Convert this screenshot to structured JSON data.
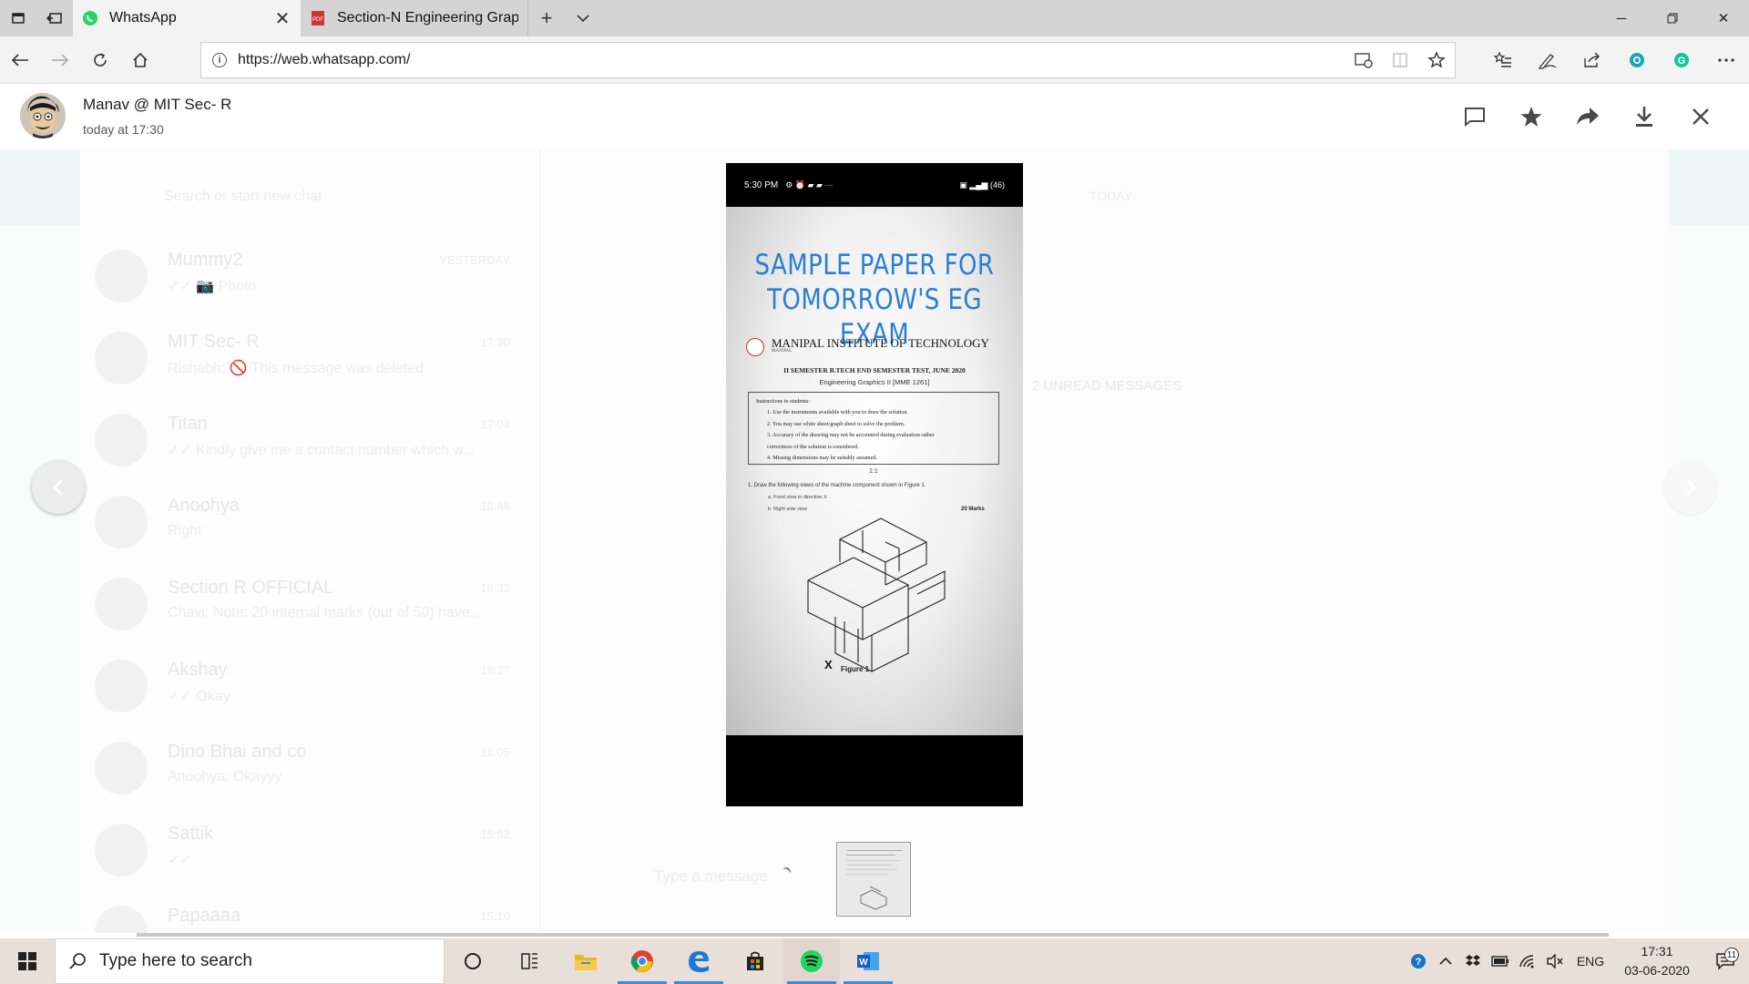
{
  "browser": {
    "tabs": [
      {
        "title": "WhatsApp",
        "active": true
      },
      {
        "title": "Section-N Engineering Grap",
        "active": false
      }
    ],
    "url": "https://web.whatsapp.com/"
  },
  "viewer": {
    "sender_name": "Manav @ MIT Sec- R",
    "timestamp": "today at 17:30",
    "actions": [
      "message-icon",
      "star-icon",
      "forward-icon",
      "download-icon",
      "close-icon"
    ]
  },
  "background_chats": {
    "search_placeholder": "Search or start new chat",
    "today_label": "TODAY",
    "unread_label": "2 UNREAD MESSAGES",
    "compose_placeholder": "Type a message",
    "items": [
      {
        "name": "Mummy2",
        "time": "YESTERDAY",
        "message": "✓✓ 📷 Photo"
      },
      {
        "name": "MIT Sec- R",
        "time": "17:30",
        "message": "Rishabh: 🚫 This message was deleted"
      },
      {
        "name": "Titan",
        "time": "17:04",
        "message": "✓✓ Kindly give me a contact number which w..."
      },
      {
        "name": "Anoohya",
        "time": "16:46",
        "message": "Right"
      },
      {
        "name": "Section R OFFICIAL",
        "time": "16:33",
        "message": "Chavi: Note: 20 internal marks (out of 50) have..."
      },
      {
        "name": "Akshay",
        "time": "16:27",
        "message": "✓✓ Okay"
      },
      {
        "name": "Dino Bhai and co",
        "time": "16:05",
        "message": "Anoohya: Okayyy"
      },
      {
        "name": "Sattik",
        "time": "15:52",
        "message": "✓✓"
      },
      {
        "name": "Papaaaa",
        "time": "15:10",
        "message": ""
      }
    ]
  },
  "photo": {
    "status_time": "5:30 PM",
    "status_right": "46",
    "title_line1": "SAMPLE PAPER FOR",
    "title_line2": "TOMORROW'S EG EXAM",
    "institute": "MANIPAL INSTITUTE OF TECHNOLOGY",
    "institute_sub": "MANIPAL",
    "exam": "II SEMESTER B.TECH END SEMESTER TEST, JUNE 2020",
    "course": "Engineering Graphics II [MME 1261]",
    "instructions_heading": "Instructions to students:",
    "instructions": [
      "1.   Use the instruments available with you to draw the solution.",
      "2.   You may use white sheet/graph sheet to solve the problem.",
      "3.   Accuracy of the drawing may not be accounted during evaluation rather",
      "      correctness of the solution is considered.",
      "4.   Missing dimensions may be suitably assumed."
    ],
    "scale_note": "1:1",
    "question": "1.     Draw the following views of the machine component shown in Figure 1.",
    "sub_a": "a.     Front view in direction X",
    "sub_b": "b.     Right side view",
    "marks": "20 Marks",
    "figure_x": "X",
    "figure_label": "Figure 1"
  },
  "taskbar": {
    "search_placeholder": "Type here to search",
    "language": "ENG",
    "time": "17:31",
    "date": "03-06-2020",
    "notifications": "11"
  }
}
